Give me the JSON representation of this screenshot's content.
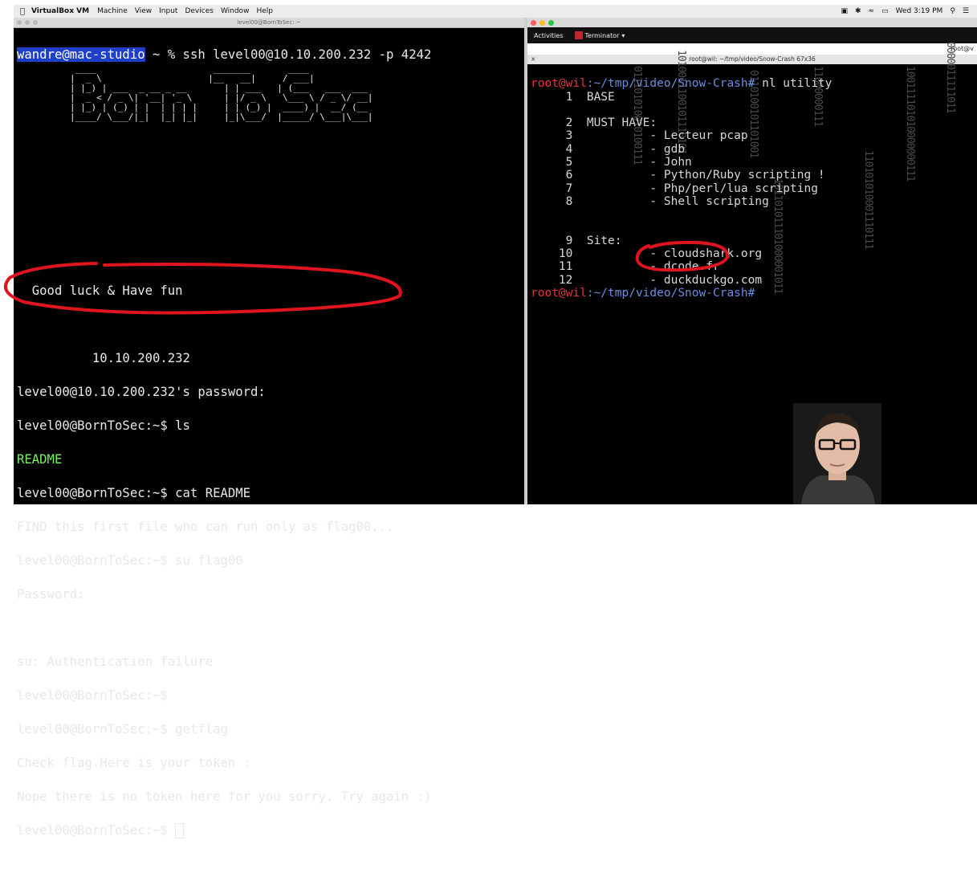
{
  "menubar": {
    "app_name": "VirtualBox VM",
    "items": [
      "Machine",
      "View",
      "Input",
      "Devices",
      "Window",
      "Help"
    ],
    "clock": "Wed 3:19 PM"
  },
  "left_terminal": {
    "window_title": "level00@BornToSec: ~",
    "lines": [
      {
        "prompt": "wandre@mac-studio",
        "rest": " ~ % ssh level00@10.10.200.232 -p 4242"
      },
      {
        "text": "  Good luck & Have fun"
      },
      {
        "text": "          10.10.200.232"
      },
      {
        "text": "level00@10.10.200.232's password:"
      },
      {
        "text": "level00@BornToSec:~$ ls"
      },
      {
        "text": "README",
        "green": true
      },
      {
        "text": "level00@BornToSec:~$ cat README"
      },
      {
        "text": "FIND this first file who can run only as flag00..."
      },
      {
        "text": "level00@BornToSec:~$ su flag00"
      },
      {
        "text": "Password:"
      },
      {
        "text": ""
      },
      {
        "text": "su: Authentication failure"
      },
      {
        "text": "level00@BornToSec:~$"
      },
      {
        "text": "level00@BornToSec:~$ getflag"
      },
      {
        "text": "Check flag.Here is your token :"
      },
      {
        "text": "Nope there is no token here for you sorry. Try again :)"
      },
      {
        "text": "level00@BornToSec:~$ "
      }
    ],
    "banner_text": "BornToSec"
  },
  "right_terminal": {
    "gnome_activities": "Activities",
    "gnome_app": "Terminator",
    "tab_label": "root@v",
    "window_title": "root@wil: ~/tmp/video/Snow-Crash 67x36",
    "prompt_user": "root@wil",
    "prompt_path": ":~/tmp/video/Snow-Crash#",
    "command": " nl utility",
    "lines": [
      "     1  BASE",
      "",
      "     2  MUST HAVE:",
      "     3           - Lecteur pcap",
      "     4           - gdb",
      "     5           - John",
      "     6           - Python/Ruby scripting !",
      "     7           - Php/perl/lua scripting",
      "     8           - Shell scripting",
      "",
      "",
      "     9  Site:",
      "    10           - cloudshark.org",
      "    11           - dcode.fr",
      "    12           - duckduckgo.com"
    ]
  },
  "colors": {
    "prompt_highlight": "#1d3fc9",
    "readme_green": "#7cf25f",
    "root_red": "#e8323a",
    "annotation_red": "#e0141e"
  }
}
